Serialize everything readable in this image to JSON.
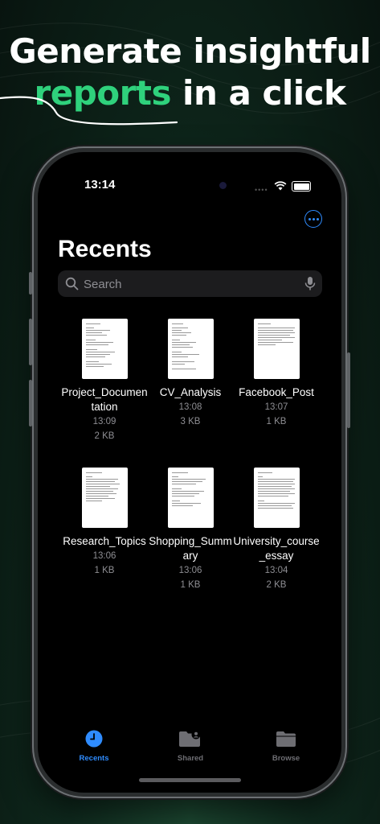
{
  "headline": {
    "line1": "Generate insightful",
    "accent": "reports",
    "line2_rest": " in a click"
  },
  "status": {
    "time": "13:14"
  },
  "screen": {
    "title": "Recents",
    "search_placeholder": "Search"
  },
  "files": [
    {
      "name": "Project_Documentation",
      "time": "13:09",
      "size": "2 KB"
    },
    {
      "name": "CV_Analysis",
      "time": "13:08",
      "size": "3 KB"
    },
    {
      "name": "Facebook_Post",
      "time": "13:07",
      "size": "1 KB"
    },
    {
      "name": "Research_Topics",
      "time": "13:06",
      "size": "1 KB"
    },
    {
      "name": "Shopping_Summary",
      "time": "13:06",
      "size": "1 KB"
    },
    {
      "name": "University_course_essay",
      "time": "13:04",
      "size": "2 KB"
    }
  ],
  "tabs": [
    {
      "label": "Recents",
      "icon": "clock-icon",
      "active": true
    },
    {
      "label": "Shared",
      "icon": "shared-folder-icon",
      "active": false
    },
    {
      "label": "Browse",
      "icon": "folder-icon",
      "active": false
    }
  ],
  "colors": {
    "accent_green": "#2fd17c",
    "ios_blue": "#2f8cff",
    "inactive_tab": "#6e6e73"
  }
}
